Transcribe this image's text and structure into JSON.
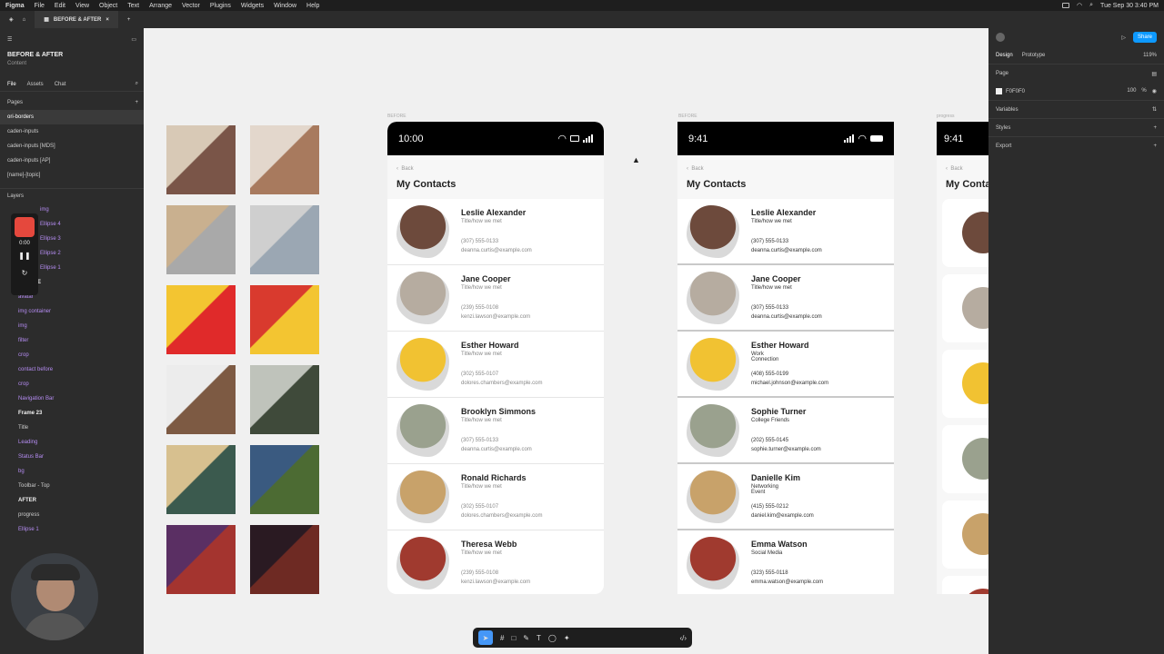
{
  "menubar": {
    "items": [
      "Figma",
      "File",
      "Edit",
      "View",
      "Object",
      "Text",
      "Arrange",
      "Vector",
      "Plugins",
      "Widgets",
      "Window",
      "Help"
    ],
    "datetime": "Tue Sep 30  3:40 PM"
  },
  "tabbar": {
    "tab_label": "BEFORE & AFTER"
  },
  "left_panel": {
    "file_title": "BEFORE & AFTER",
    "file_subtitle": "Content",
    "tabs": [
      "File",
      "Assets",
      "Chat"
    ],
    "pages_label": "Pages",
    "pages": [
      "ori-borders",
      "caden-inputs",
      "caden-inputs [MDS]",
      "caden-inputs [AP]",
      "[name]-[topic]"
    ],
    "layers_label": "Layers",
    "rec_time": "0:00",
    "layers": [
      "img",
      "Ellipse 4",
      "Ellipse 3",
      "Ellipse 2",
      "Ellipse 1",
      "BEFORE",
      "avatar",
      "img container",
      "img",
      "filter",
      "crop",
      "contact before",
      "crop",
      "Navigation Bar",
      "Frame 23",
      "Title",
      "Leading",
      "Status Bar",
      "bg",
      "Toolbar - Top",
      "AFTER",
      "progress",
      "Ellipse 1"
    ]
  },
  "right_panel": {
    "tabs": [
      "Design",
      "Prototype"
    ],
    "zoom": "119%",
    "share_label": "Share",
    "page_label": "Page",
    "fill_hex": "F0F0F0",
    "fill_opacity": "100",
    "fill_unit": "%",
    "sections": [
      "Variables",
      "Styles",
      "Export"
    ]
  },
  "canvas": {
    "frame_labels": [
      "BEFORE",
      "BEFORE",
      "progress"
    ],
    "before": {
      "time": "10:00",
      "back": "Back",
      "title": "My Contacts",
      "contacts": [
        {
          "name": "Leslie Alexander",
          "sub": "Title/how we met",
          "phone": "(307) 555-0133",
          "email": "deanna.curtis@example.com"
        },
        {
          "name": "Jane Cooper",
          "sub": "Title/how we met",
          "phone": "(239) 555-0108",
          "email": "kenzi.lawson@example.com"
        },
        {
          "name": "Esther Howard",
          "sub": "Title/how we met",
          "phone": "(302) 555-0107",
          "email": "dolores.chambers@example.com"
        },
        {
          "name": "Brooklyn Simmons",
          "sub": "Title/how we met",
          "phone": "(307) 555-0133",
          "email": "deanna.curtis@example.com"
        },
        {
          "name": "Ronald Richards",
          "sub": "Title/how we met",
          "phone": "(302) 555-0107",
          "email": "dolores.chambers@example.com"
        },
        {
          "name": "Theresa Webb",
          "sub": "Title/how we met",
          "phone": "(239) 555-0108",
          "email": "kenzi.lawson@example.com"
        }
      ]
    },
    "after": {
      "time": "9:41",
      "back": "Back",
      "title": "My Contacts",
      "contacts": [
        {
          "name": "Leslie Alexander",
          "sub": "Title/how we met",
          "phone": "(307) 555-0133",
          "email": "deanna.curtis@example.com"
        },
        {
          "name": "Jane Cooper",
          "sub": "Title/how we met",
          "phone": "(307) 555-0133",
          "email": "deanna.curtis@example.com"
        },
        {
          "name": "Esther Howard",
          "sub": "Work\nConnection",
          "phone": "(408) 555-0199",
          "email": "michael.johnson@example.com"
        },
        {
          "name": "Sophie Turner",
          "sub": "College Friends",
          "phone": "(202) 555-0145",
          "email": "sophie.turner@example.com"
        },
        {
          "name": "Danielle Kim",
          "sub": "Networking\nEvent",
          "phone": "(415) 555-0212",
          "email": "daniel.kim@example.com"
        },
        {
          "name": "Emma Watson",
          "sub": "Social Media",
          "phone": "(323) 555-0118",
          "email": "emma.watson@example.com"
        }
      ]
    },
    "third": {
      "time": "9:41",
      "back": "Back",
      "title": "My Conta"
    }
  },
  "colors": {
    "accent": "#4597f7",
    "dark": "#2c2c2c",
    "canvas": "#f0f0f0"
  }
}
